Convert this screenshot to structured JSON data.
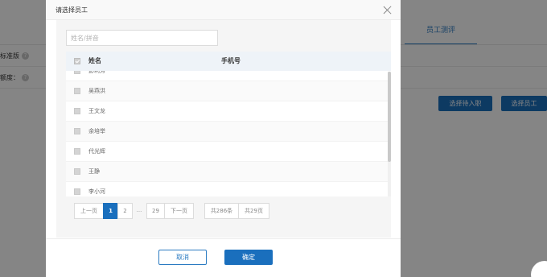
{
  "background": {
    "tab_label": "员工测评",
    "row1_label": "标准版",
    "row2_label": "额度：",
    "help_icon_glyph": "?",
    "btn_select_pending": "选择待入职",
    "btn_select_employee": "选择员工",
    "accent_color": "#1a6fbd"
  },
  "modal": {
    "title": "请选择员工",
    "close_icon": "close-icon",
    "search_placeholder": "姓名/拼音",
    "columns": {
      "name": "姓名",
      "phone": "手机号"
    },
    "rows": [
      {
        "name": "彭利芳",
        "phone": ""
      },
      {
        "name": "吴燕洪",
        "phone": ""
      },
      {
        "name": "王文龙",
        "phone": ""
      },
      {
        "name": "余培举",
        "phone": ""
      },
      {
        "name": "代光辉",
        "phone": ""
      },
      {
        "name": "王静",
        "phone": ""
      },
      {
        "name": "李小河",
        "phone": ""
      }
    ],
    "pagination": {
      "prev": "上一页",
      "current": "1",
      "page2": "2",
      "ellipsis": "...",
      "last": "29",
      "next": "下一页",
      "total_records": "共286条",
      "total_pages": "共29页"
    },
    "footer": {
      "cancel": "取消",
      "ok": "确定"
    }
  }
}
